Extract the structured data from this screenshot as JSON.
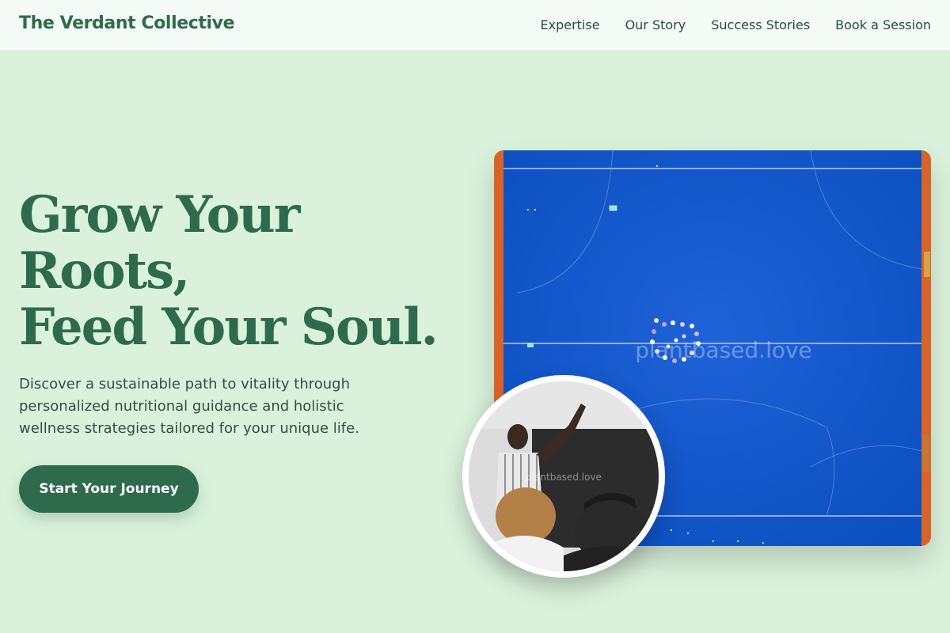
{
  "header": {
    "brand": "The Verdant Collective",
    "nav": [
      "Expertise",
      "Our Story",
      "Success Stories",
      "Book a Session"
    ]
  },
  "hero": {
    "headline_lines": [
      "Grow Your",
      "Roots,",
      "Feed Your Soul."
    ],
    "description": "Discover a sustainable path to vitality through personalized nutritional guidance and holistic wellness strategies tailored for your unique life.",
    "cta_label": "Start Your Journey"
  },
  "images": {
    "main_watermark": "plantbased.love",
    "circle_watermark": "plantbased.love"
  },
  "colors": {
    "background": "#daf2dc",
    "brand_green": "#2e6b4c",
    "court_blue": "#0b56c6",
    "court_border": "#d9642a"
  }
}
